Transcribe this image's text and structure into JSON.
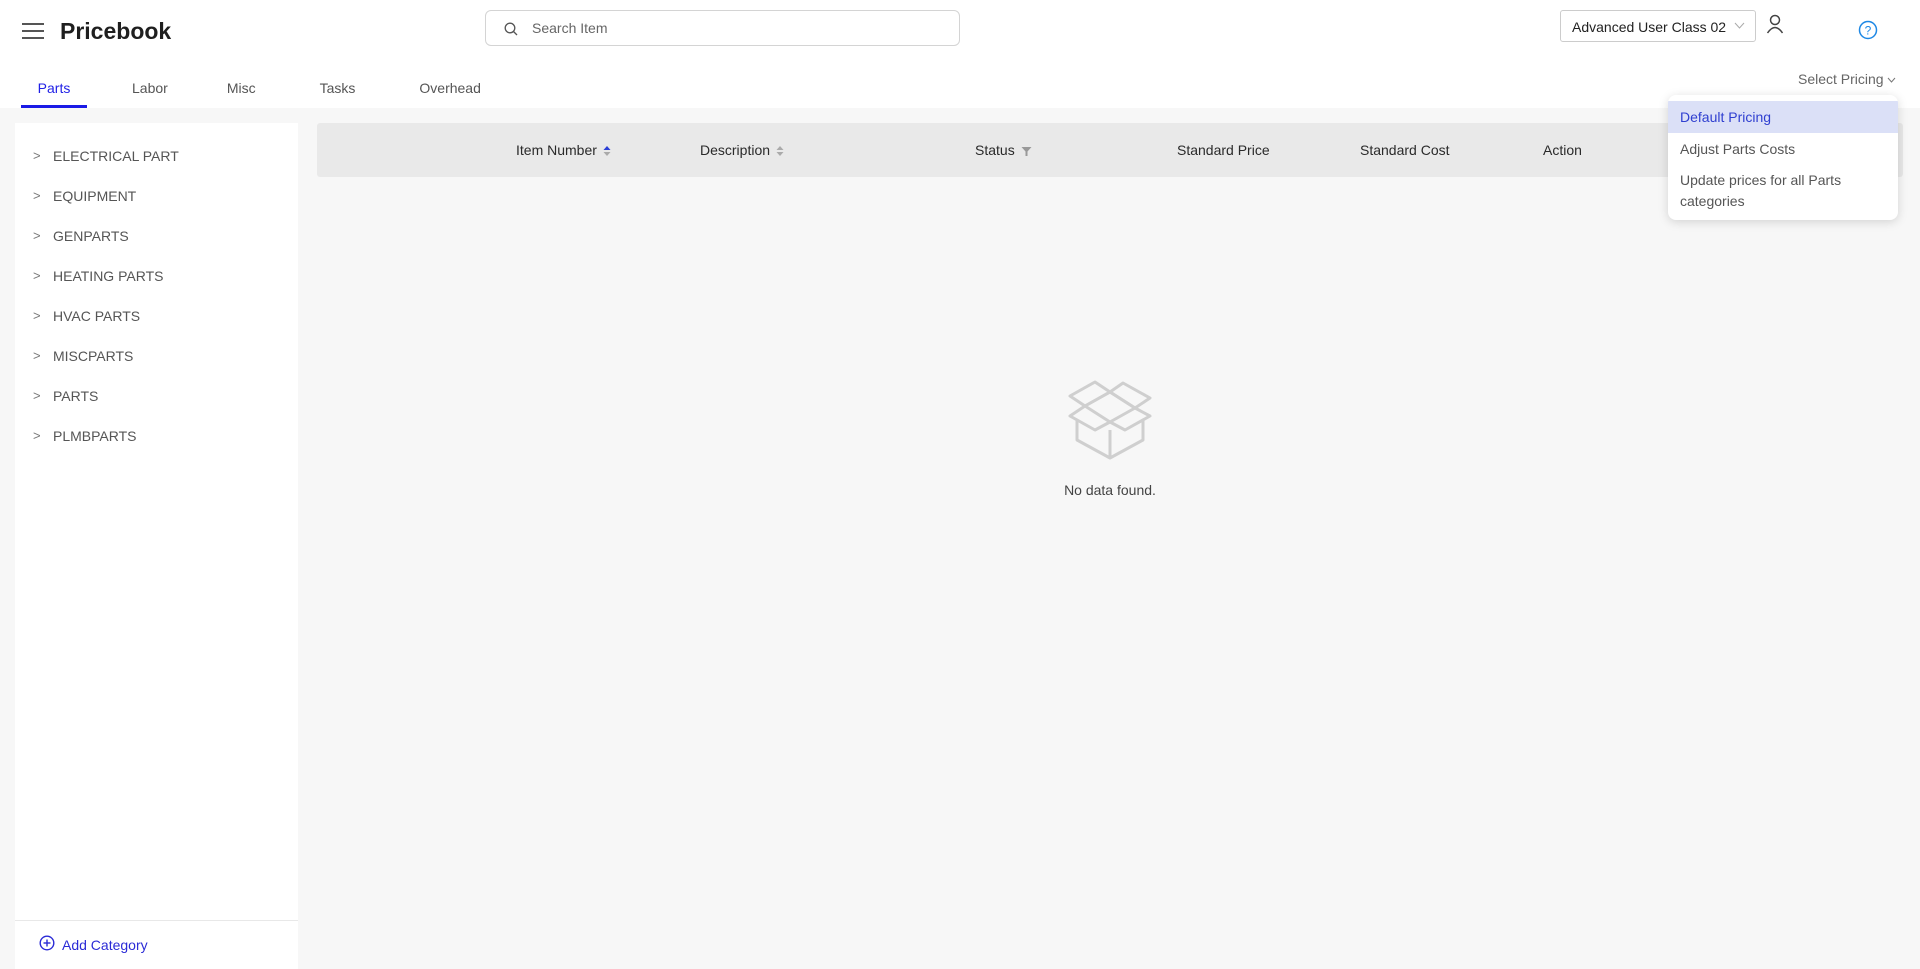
{
  "header": {
    "title": "Pricebook",
    "menu_icon": "hamburger-menu-icon",
    "search": {
      "placeholder": "Search Item",
      "value": "",
      "icon": "search-icon"
    },
    "user_class": {
      "selected": "Advanced User Class 02",
      "icon": "chevron-down-icon"
    },
    "user_icon": "user-icon",
    "help_icon": "help-icon"
  },
  "tabs": [
    {
      "label": "Parts",
      "active": true
    },
    {
      "label": "Labor",
      "active": false
    },
    {
      "label": "Misc",
      "active": false
    },
    {
      "label": "Tasks",
      "active": false
    },
    {
      "label": "Overhead",
      "active": false
    }
  ],
  "pricing": {
    "label": "Select Pricing",
    "options": [
      {
        "label": "Default Pricing",
        "selected": true
      },
      {
        "label": "Adjust Parts Costs",
        "selected": false
      },
      {
        "label": "Update prices for all Parts categories",
        "selected": false
      }
    ]
  },
  "sidebar": {
    "categories": [
      {
        "label": "ELECTRICAL PART"
      },
      {
        "label": "EQUIPMENT"
      },
      {
        "label": "GENPARTS"
      },
      {
        "label": "HEATING PARTS"
      },
      {
        "label": "HVAC PARTS"
      },
      {
        "label": "MISCPARTS"
      },
      {
        "label": "PARTS"
      },
      {
        "label": "PLMBPARTS"
      }
    ],
    "add_category_label": "Add Category"
  },
  "table": {
    "columns": [
      {
        "label": "Item Number",
        "sort": "ascending"
      },
      {
        "label": "Description",
        "sort": "none"
      },
      {
        "label": "Status",
        "filter": true
      },
      {
        "label": "Standard Price"
      },
      {
        "label": "Standard Cost"
      },
      {
        "label": "Action"
      }
    ],
    "rows": [],
    "empty_text": "No data found."
  },
  "colors": {
    "accent": "#1a1ae6",
    "selected_bg": "#dbe0f7",
    "help_blue": "#1e88e5"
  }
}
